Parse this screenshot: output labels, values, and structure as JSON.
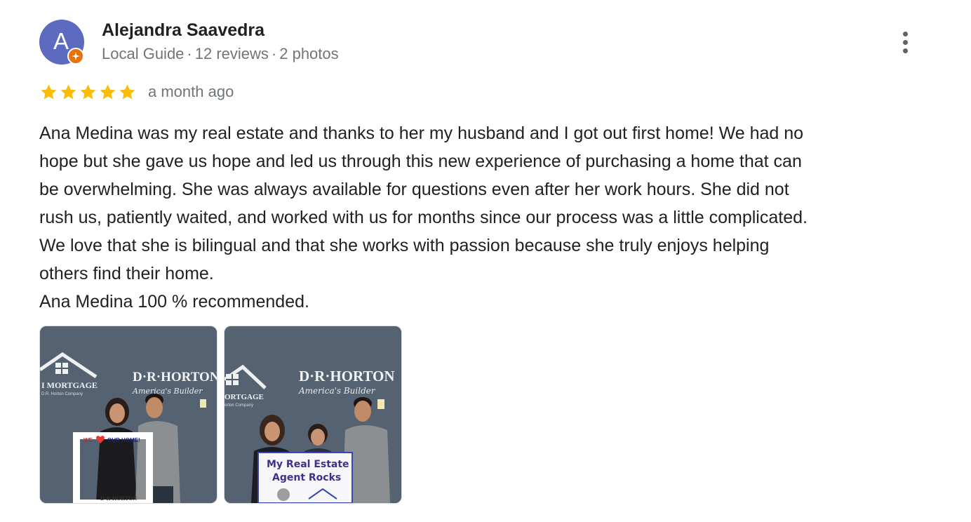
{
  "reviewer": {
    "avatar_letter": "A",
    "avatar_color": "#5c6bc0",
    "badge_color": "#e8710a",
    "name": "Alejandra Saavedra",
    "guide_label": "Local Guide",
    "separator": "·",
    "reviews": "12 reviews",
    "photos": "2 photos"
  },
  "menu": {
    "icon": "more-vert-icon"
  },
  "rating": {
    "stars": 5,
    "max_stars": 5,
    "star_color": "#fbbc04",
    "date": "a month ago"
  },
  "review": {
    "lines": [
      "Ana Medina was my real estate and thanks to her my husband and I got out first home! We had no",
      "hope but she gave us hope and led us through this new experience of purchasing a home that can",
      "be overwhelming. She was always available for questions even after her work hours. She did not",
      "rush us, patiently waited, and worked with us for months since our process was a little complicated.",
      "We love that she is bilingual and that she works with passion because she truly enjoys helping",
      "others find their home.",
      "Ana Medina 100 % recommended."
    ]
  },
  "photos": [
    {
      "logo_left": "I MORTGAGE",
      "logo_left_sub": "D.R. Horton Company",
      "brand": "D·R·HORTON",
      "tagline": "America's Builder",
      "frame_text_1": "WE",
      "frame_text_2": "OUR HOME!",
      "frame_footer": "D·R·HORTON"
    },
    {
      "logo_left": "ORTGAGE",
      "logo_left_sub": "orton Company",
      "brand": "D·R·HORTON",
      "tagline": "America's Builder",
      "sign_line_1": "My Real Estate",
      "sign_line_2": "Agent Rocks"
    }
  ]
}
